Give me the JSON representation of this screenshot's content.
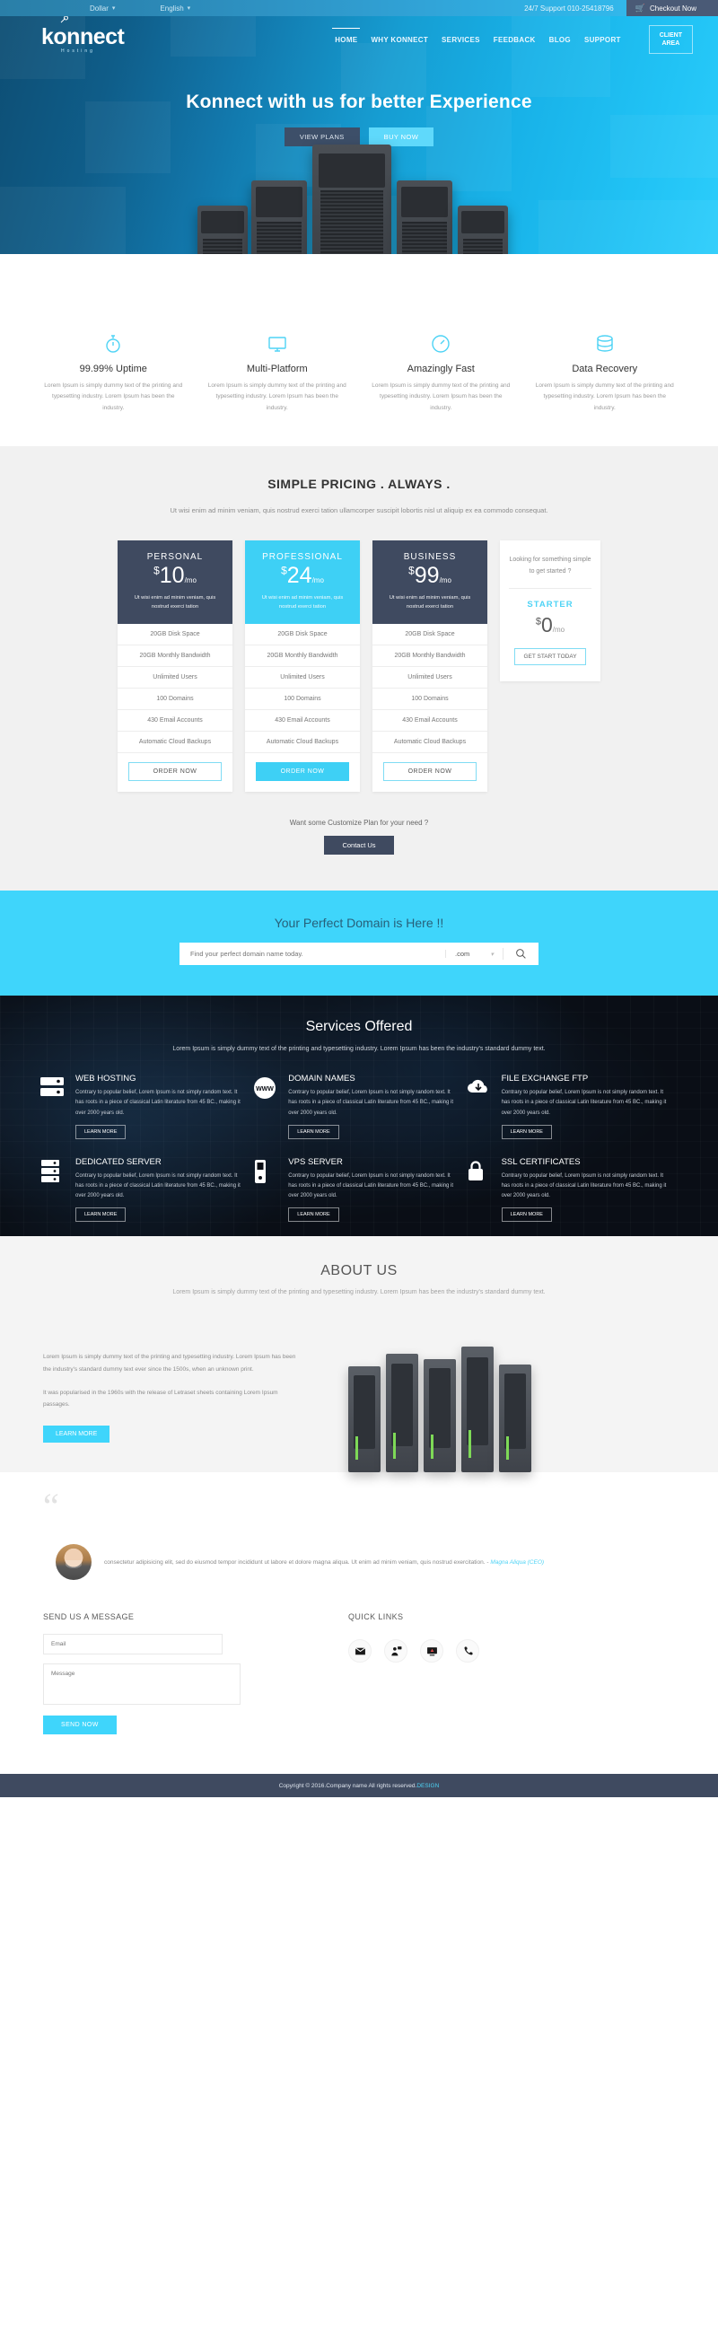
{
  "topbar": {
    "currency": "Dollar",
    "language": "English",
    "support": "24/7 Support 010-25418796",
    "checkout": "Checkout Now",
    "cart_icon": "cart-icon",
    "caret_icon": "chevron-down-icon"
  },
  "header": {
    "logo": "konnect",
    "logo_sub": "Hosting",
    "nav": [
      {
        "label": "HOME",
        "active": true
      },
      {
        "label": "WHY KONNECT",
        "active": false
      },
      {
        "label": "SERVICES",
        "active": false
      },
      {
        "label": "FEEDBACK",
        "active": false
      },
      {
        "label": "BLOG",
        "active": false
      },
      {
        "label": "SUPPORT",
        "active": false
      }
    ],
    "client_area_line1": "CLIENT",
    "client_area_line2": "AREA"
  },
  "hero": {
    "title": "Konnect with us for better Experience",
    "btn_plans": "VIEW PLANS",
    "btn_buy": "BUY NOW"
  },
  "features": [
    {
      "icon": "stopwatch-icon",
      "title": "99.99% Uptime",
      "text": "Lorem Ipsum is simply dummy text of the printing and typesetting industry. Lorem Ipsum has been the industry."
    },
    {
      "icon": "monitor-icon",
      "title": "Multi-Platform",
      "text": "Lorem Ipsum is simply dummy text of the printing and typesetting industry. Lorem Ipsum has been the industry."
    },
    {
      "icon": "speedometer-icon",
      "title": "Amazingly Fast",
      "text": "Lorem Ipsum is simply dummy text of the printing and typesetting industry. Lorem Ipsum has been the industry."
    },
    {
      "icon": "database-icon",
      "title": "Data Recovery",
      "text": "Lorem Ipsum is simply dummy text of the printing and typesetting industry. Lorem Ipsum has been the industry."
    }
  ],
  "pricing": {
    "heading": "SIMPLE PRICING . ALWAYS .",
    "subheading": "Ut wisi enim ad minim veniam, quis nostrud exerci tation ullamcorper suscipit lobortis nisl ut aliquip ex ea commodo consequat.",
    "plans": [
      {
        "name": "PERSONAL",
        "currency": "$",
        "price": "10",
        "period": "/mo",
        "desc": "Ut wisi enim ad minim veniam, quis nostrud exerci tation",
        "features": [
          "20GB Disk Space",
          "20GB Monthly Bandwidth",
          "Unlimited Users",
          "100 Domains",
          "430 Email Accounts",
          "Automatic Cloud Backups"
        ],
        "cta": "ORDER NOW",
        "featured": false
      },
      {
        "name": "PROFESSIONAL",
        "currency": "$",
        "price": "24",
        "period": "/mo",
        "desc": "Ut wisi enim ad minim veniam, quis nostrud exerci tation",
        "features": [
          "20GB Disk Space",
          "20GB Monthly Bandwidth",
          "Unlimited Users",
          "100 Domains",
          "430 Email Accounts",
          "Automatic Cloud Backups"
        ],
        "cta": "ORDER NOW",
        "featured": true
      },
      {
        "name": "BUSINESS",
        "currency": "$",
        "price": "99",
        "period": "/mo",
        "desc": "Ut wisi enim ad minim veniam, quis nostrud exerci tation",
        "features": [
          "20GB Disk Space",
          "20GB Monthly Bandwidth",
          "Unlimited Users",
          "100 Domains",
          "430 Email Accounts",
          "Automatic Cloud Backups"
        ],
        "cta": "ORDER NOW",
        "featured": false
      }
    ],
    "starter": {
      "question": "Looking for something simple to get started ?",
      "name": "STARTER",
      "currency": "$",
      "price": "0",
      "period": "/mo",
      "cta": "GET START TODAY"
    },
    "customize_text": "Want some Customize Plan for your need ?",
    "customize_cta": "Contact Us"
  },
  "domain": {
    "heading": "Your Perfect Domain is Here !!",
    "placeholder": "Find your perfect domain name today.",
    "tld": ".com",
    "search_icon": "search-icon",
    "caret_icon": "chevron-down-icon"
  },
  "services": {
    "heading": "Services Offered",
    "subheading": "Lorem Ipsum is simply dummy text of the printing and typesetting industry. Lorem Ipsum has been the industry's standard dummy text.",
    "items": [
      {
        "icon": "server-icon",
        "title": "WEB HOSTING",
        "text": "Contrary to popular belief, Lorem Ipsum is not simply random text. It has roots in a piece of classical Latin literature from 45 BC., making it over 2000 years old.",
        "cta": "LEARN MORE"
      },
      {
        "icon": "www-globe-icon",
        "title": "DOMAIN NAMES",
        "text": "Contrary to popular belief, Lorem Ipsum is not simply random text. It has roots in a piece of classical Latin literature from 45 BC., making it over 2000 years old.",
        "cta": "LEARN MORE"
      },
      {
        "icon": "cloud-icon",
        "title": "FILE EXCHANGE FTP",
        "text": "Contrary to popular belief, Lorem Ipsum is not simply random text. It has roots in a piece of classical Latin literature from 45 BC., making it over 2000 years old.",
        "cta": "LEARN MORE"
      },
      {
        "icon": "rack-icon",
        "title": "DEDICATED SERVER",
        "text": "Contrary to popular belief, Lorem Ipsum is not simply random text. It has roots in a piece of classical Latin literature from 45 BC., making it over 2000 years old.",
        "cta": "LEARN MORE"
      },
      {
        "icon": "tower-icon",
        "title": "VPS SERVER",
        "text": "Contrary to popular belief, Lorem Ipsum is not simply random text. It has roots in a piece of classical Latin literature from 45 BC., making it over 2000 years old.",
        "cta": "LEARN MORE"
      },
      {
        "icon": "lock-icon",
        "title": "SSL CERTIFICATES",
        "text": "Contrary to popular belief, Lorem Ipsum is not simply random text. It has roots in a piece of classical Latin literature from 45 BC., making it over 2000 years old.",
        "cta": "LEARN MORE"
      }
    ]
  },
  "about": {
    "heading": "ABOUT US",
    "subheading": "Lorem Ipsum is simply dummy text of the printing and typesetting industry. Lorem Ipsum has been the industry's standard dummy text.",
    "para1": "Lorem Ipsum is simply dummy text of the printing and typesetting industry. Lorem Ipsum has been the industry's standard dummy text ever since the 1500s, when an unknown print.",
    "para2": "It was popularised in the 1960s with the release of Letraset sheets containing Lorem Ipsum passages.",
    "cta": "LEARN MORE"
  },
  "testimonial": {
    "quote_mark": "“",
    "text": "consectetur adipisicing elit, sed do eiusmod tempor incididunt ut labore et dolore magna aliqua. Ut enim ad minim veniam, quis nostrud exercitation. - ",
    "author": "Magna Aliqua (CEO)",
    "avatar": "avatar"
  },
  "contact": {
    "heading": "SEND US A MESSAGE",
    "email_placeholder": "Email",
    "message_placeholder": "Message",
    "send_label": "SEND NOW"
  },
  "quicklinks": {
    "heading": "QUICK LINKS",
    "items": [
      {
        "icon": "envelope-icon",
        "name": "email-link"
      },
      {
        "icon": "support-agent-icon",
        "name": "support-link"
      },
      {
        "icon": "monitor-alert-icon",
        "name": "status-link"
      },
      {
        "icon": "phone-icon",
        "name": "phone-link"
      }
    ]
  },
  "footer": {
    "copyright": "Copyright © 2016.Company name All rights reserved.",
    "link": "DESIGN"
  },
  "colors": {
    "cyan": "#3fd5fb",
    "dark": "#3f4a60",
    "hero_blue": "#169dd2"
  }
}
